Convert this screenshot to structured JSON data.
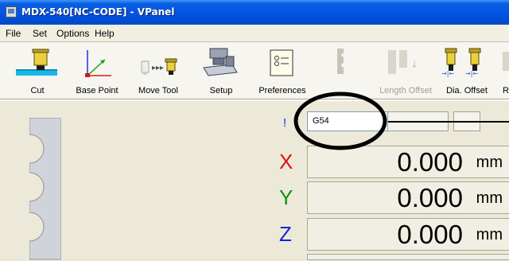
{
  "window": {
    "title": "MDX-540[NC-CODE] - VPanel"
  },
  "menu": [
    {
      "label": "File"
    },
    {
      "label": "Set"
    },
    {
      "label": "Options"
    },
    {
      "label": "Help"
    }
  ],
  "toolbar": {
    "items": [
      {
        "id": "cut",
        "label": "Cut",
        "icon": "cut-icon",
        "enabled": true
      },
      {
        "id": "base-point",
        "label": "Base Point",
        "icon": "base-point-icon",
        "enabled": true
      },
      {
        "id": "move-tool",
        "label": "Move Tool",
        "icon": "move-tool-icon",
        "enabled": true
      },
      {
        "id": "setup",
        "label": "Setup",
        "icon": "setup-machine-icon",
        "enabled": true
      },
      {
        "id": "preferences",
        "label": "Preferences",
        "icon": "preferences-icon",
        "enabled": true
      },
      {
        "id": "length-offset",
        "label": "Length Offset",
        "icon": "length-offset-icon",
        "enabled": false
      },
      {
        "id": "dia-offset",
        "label": "Dia. Offset",
        "icon": "dia-offset-icon",
        "enabled": true
      },
      {
        "id": "partial",
        "label": "R",
        "icon": "unknown-icon",
        "enabled": true
      }
    ]
  },
  "coordinates": {
    "indicator": "!",
    "system": "G54",
    "axes": [
      {
        "axis": "X",
        "value": "0.000",
        "unit": "mm",
        "color": "#e01010"
      },
      {
        "axis": "Y",
        "value": "0.000",
        "unit": "mm",
        "color": "#109010"
      },
      {
        "axis": "Z",
        "value": "0.000",
        "unit": "mm",
        "color": "#1028d0"
      }
    ]
  },
  "colors": {
    "titlebar": "#0054e3",
    "workpiece": "#cfd3da",
    "highlight": "#000000"
  }
}
